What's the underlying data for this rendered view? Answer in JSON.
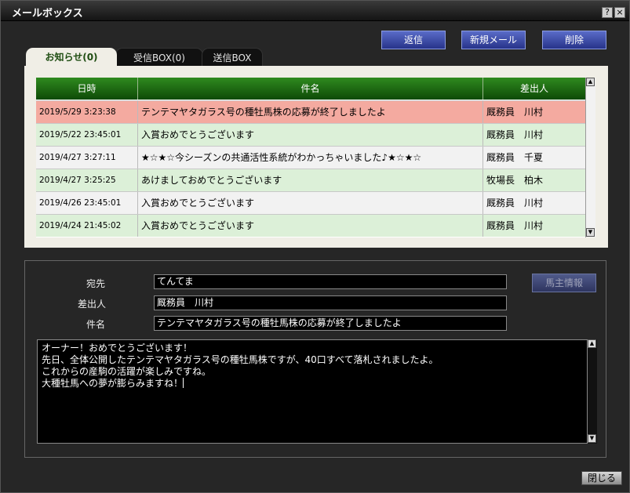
{
  "window": {
    "title": "メールボックス",
    "help_label": "?",
    "close_label": "×"
  },
  "toolbar": {
    "reply_label": "返信",
    "new_mail_label": "新規メール",
    "delete_label": "削除"
  },
  "tabs": [
    {
      "label": "お知らせ(0)",
      "active": true
    },
    {
      "label": "受信BOX(0)",
      "active": false
    },
    {
      "label": "送信BOX",
      "active": false
    }
  ],
  "mail_list": {
    "columns": [
      "日時",
      "件名",
      "差出人"
    ],
    "rows": [
      {
        "date": "2019/5/29 3:23:38",
        "subject": "テンテマヤタガラス号の種牡馬株の応募が終了しましたよ",
        "sender": "厩務員　川村",
        "color": "#f4aaa0"
      },
      {
        "date": "2019/5/22 23:45:01",
        "subject": "入賞おめでとうございます",
        "sender": "厩務員　川村",
        "color": "#dcf0d8"
      },
      {
        "date": "2019/4/27 3:27:11",
        "subject": "★☆★☆今シーズンの共通活性系統がわかっちゃいました♪★☆★☆",
        "sender": "厩務員　千夏",
        "color": "#f2f2f2"
      },
      {
        "date": "2019/4/27 3:25:25",
        "subject": "あけましておめでとうございます",
        "sender": "牧場長　柏木",
        "color": "#dcf0d8"
      },
      {
        "date": "2019/4/26 23:45:01",
        "subject": "入賞おめでとうございます",
        "sender": "厩務員　川村",
        "color": "#f2f2f2"
      },
      {
        "date": "2019/4/24 21:45:02",
        "subject": "入賞おめでとうございます",
        "sender": "厩務員　川村",
        "color": "#dcf0d8"
      }
    ]
  },
  "detail": {
    "to_label": "宛先",
    "to_value": "てんてま",
    "from_label": "差出人",
    "from_value": "厩務員　川村",
    "subject_label": "件名",
    "subject_value": "テンテマヤタガラス号の種牡馬株の応募が終了しましたよ",
    "owner_info_label": "馬主情報",
    "body_lines": [
      "オーナー！おめでとうございます！",
      "",
      "先日、全体公開したテンテマヤタガラス号の種牡馬株ですが、40口すべて落札されましたよ。",
      "",
      "これからの産駒の活躍が楽しみですね。",
      "大種牡馬への夢が膨らみますね！"
    ]
  },
  "footer": {
    "close_label": "閉じる"
  },
  "icons": {
    "scroll_up": "up-arrow-icon",
    "scroll_down": "down-arrow-icon"
  }
}
